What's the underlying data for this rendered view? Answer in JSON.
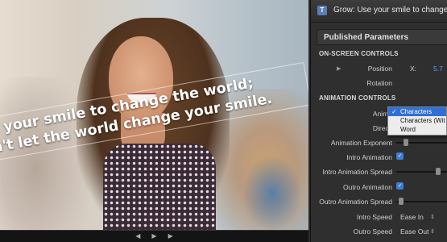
{
  "viewer": {
    "overlay_line1": "e your smile to change the world;",
    "overlay_line2": "n't let the world change your smile.",
    "transport": {
      "prev": "◀",
      "play": "▶",
      "next": "▶"
    }
  },
  "inspector": {
    "title": "Grow: Use your smile to change the",
    "tab": "Published Parameters",
    "onscreen_section": "ON-SCREEN CONTROLS",
    "position_label": "Position",
    "position_x_label": "X:",
    "position_x_value": "5.7",
    "rotation_label": "Rotation",
    "animation_section": "ANIMATION CONTROLS",
    "animate_label": "Anima",
    "direction_label": "Directi",
    "animation_exponent_label": "Animation Exponent",
    "intro_animation_label": "Intro Animation",
    "intro_animation_spread_label": "Intro Animation Spread",
    "outro_animation_label": "Outro Animation",
    "outro_animation_spread_label": "Outro Animation Spread",
    "intro_speed_label": "Intro Speed",
    "intro_speed_value": "Ease In",
    "outro_speed_label": "Outro Speed",
    "outro_speed_value": "Ease Out",
    "intro_animation_checked": true,
    "outro_animation_checked": true,
    "animation_exponent_level": 0.15,
    "intro_spread_level": 0.85,
    "outro_spread_level": 0.05
  },
  "dropdown": {
    "options": [
      "Characters",
      "Characters (Wit",
      "Word"
    ],
    "selected_index": 0
  },
  "colors": {
    "accent": "#2f6fd6",
    "value_blue": "#5aa0ff",
    "panel_bg": "#2f2f2f"
  }
}
